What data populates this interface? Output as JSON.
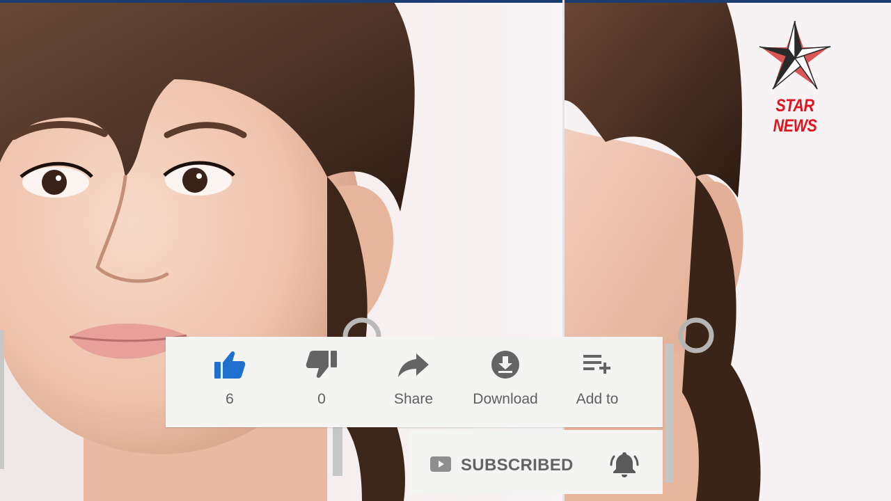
{
  "video_overlay": {
    "actions": [
      {
        "id": "like",
        "label": "6",
        "icon": "thumbs-up-icon",
        "active": true
      },
      {
        "id": "dislike",
        "label": "0",
        "icon": "thumbs-down-icon",
        "active": false
      },
      {
        "id": "share",
        "label": "Share",
        "icon": "share-icon",
        "active": false
      },
      {
        "id": "download",
        "label": "Download",
        "icon": "download-icon",
        "active": false
      },
      {
        "id": "add_to",
        "label": "Add to",
        "icon": "playlist-add-icon",
        "active": false
      }
    ],
    "subscribe": {
      "label": "SUBSCRIBED",
      "icon": "youtube-play-icon",
      "bell_icon": "bell-icon"
    }
  },
  "logo": {
    "text": "STAR NEWS",
    "icon": "nautical-star-icon"
  },
  "colors": {
    "like_active": "#1f6fd1",
    "action_inactive": "#646464",
    "logo_red": "#e0141c",
    "top_bar": "#1c3d72",
    "overlay_bg": "#f4f5f3"
  }
}
